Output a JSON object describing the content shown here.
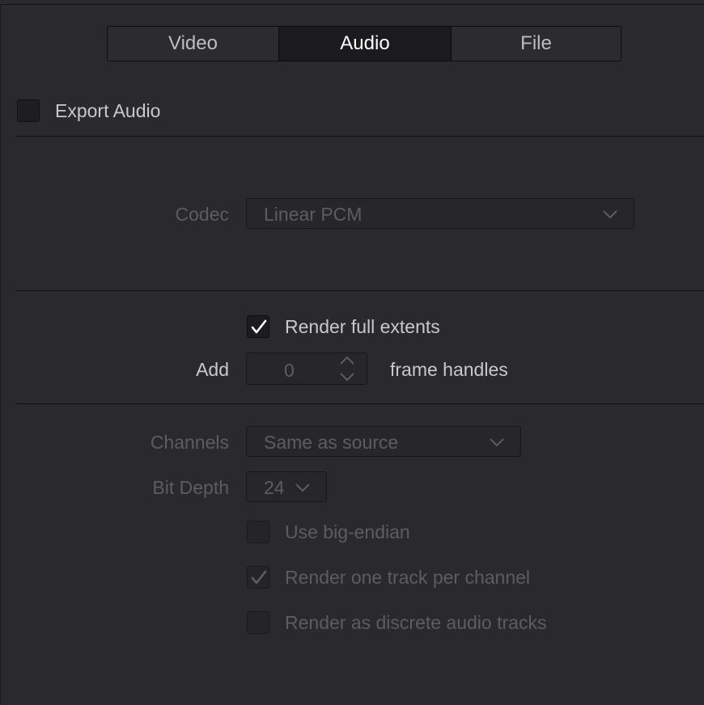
{
  "tabs": [
    {
      "label": "Video",
      "active": false
    },
    {
      "label": "Audio",
      "active": true
    },
    {
      "label": "File",
      "active": false
    }
  ],
  "export_audio": {
    "label": "Export Audio",
    "checked": false
  },
  "codec": {
    "label": "Codec",
    "value": "Linear PCM"
  },
  "render_full_extents": {
    "label": "Render full extents",
    "checked": true
  },
  "handles": {
    "prefix": "Add",
    "value": "0",
    "suffix": "frame handles"
  },
  "channels": {
    "label": "Channels",
    "value": "Same as source"
  },
  "bit_depth": {
    "label": "Bit Depth",
    "value": "24"
  },
  "options": {
    "big_endian": {
      "label": "Use big-endian",
      "checked": false
    },
    "one_track_per_channel": {
      "label": "Render one track per channel",
      "checked": true
    },
    "discrete_audio_tracks": {
      "label": "Render as discrete audio tracks",
      "checked": false
    }
  },
  "colors": {
    "background": "#29292e",
    "active_tab": "#1b1b1e",
    "disabled_text": "#5c5c62"
  }
}
